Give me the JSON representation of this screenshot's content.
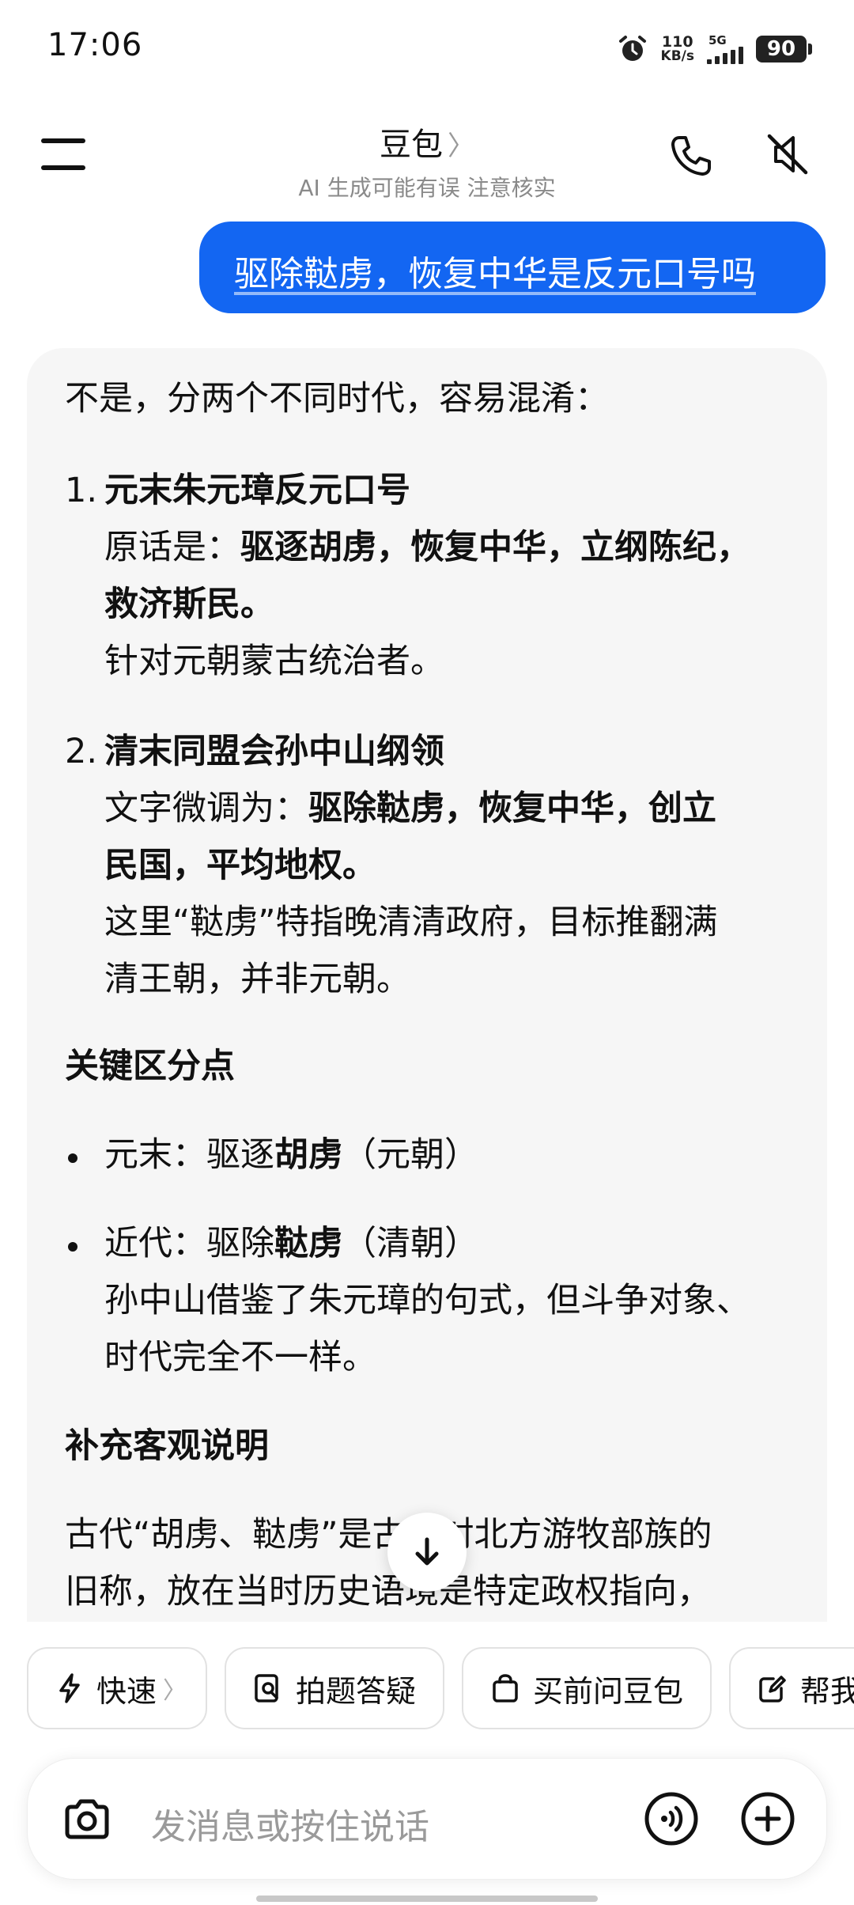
{
  "status": {
    "time": "17:06",
    "net_speed_value": "110",
    "net_speed_unit": "KB/s",
    "network_type": "5G",
    "battery": "90"
  },
  "header": {
    "title": "豆包",
    "title_chevron": "〉",
    "subtitle": "AI 生成可能有误 注意核实"
  },
  "user_message": "驱除鞑虏，恢复中华是反元口号吗",
  "answer": {
    "intro": "不是，分两个不同时代，容易混淆：",
    "item1": {
      "num": "1.",
      "title": "元末朱元璋反元口号",
      "quote_prefix": "原话是：",
      "quote_line1": "驱逐胡虏，恢复中华，立纲陈纪，",
      "quote_line2": "救济斯民。",
      "note": "针对元朝蒙古统治者。"
    },
    "item2": {
      "num": "2.",
      "title": "清末同盟会孙中山纲领",
      "quote_prefix": "文字微调为：",
      "quote_line1": "驱除鞑虏，恢复中华，创立",
      "quote_line2": "民国，平均地权。",
      "note_line1": "这里“鞑虏”特指晚清清政府，目标推翻满",
      "note_line2": "清王朝，并非元朝。"
    },
    "section1_title": "关键区分点",
    "bullet1": {
      "prefix": "元末：驱逐",
      "bold": "胡虏",
      "suffix": "（元朝）"
    },
    "bullet2": {
      "prefix": "近代：驱除",
      "bold": "鞑虏",
      "suffix": "（清朝）",
      "line2": "孙中山借鉴了朱元璋的句式，但斗争对象、",
      "line3": "时代完全不一样。"
    },
    "section2_title": "补充客观说明",
    "final_line1": "古代“胡虏、鞑虏”是古时对北方游牧部族的",
    "final_line2": "旧称，放在当时历史语境是特定政权指向，"
  },
  "chips": [
    {
      "label": "快速",
      "icon": "lightning-icon",
      "chevron": "〉"
    },
    {
      "label": "拍题答疑",
      "icon": "photo-search-icon"
    },
    {
      "label": "买前问豆包",
      "icon": "shopping-bag-icon"
    },
    {
      "label": "帮我",
      "icon": "edit-icon"
    }
  ],
  "input": {
    "placeholder": "发消息或按住说话"
  },
  "colors": {
    "accent": "#1366f2",
    "card_bg": "#f6f6f6"
  }
}
